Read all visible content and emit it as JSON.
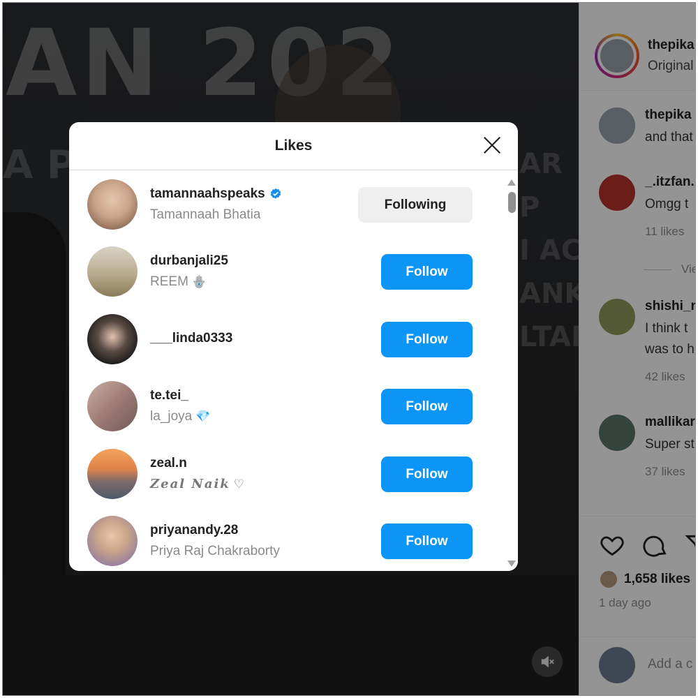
{
  "media": {
    "bg_text_line1": "AN 202",
    "bg_text_line2": "A PA   ND",
    "side_text": "AR P\nI AC\nANKA\nLTANT"
  },
  "panel": {
    "username": "thepika",
    "subtitle": "Original",
    "comments": [
      {
        "name": "thepika",
        "text": "and that",
        "likes": ""
      },
      {
        "name": "_.itzfan.",
        "text": "Omgg t",
        "likes": "11 likes"
      },
      {
        "name": "shishi_n",
        "text": "I think t\nwas to h",
        "likes": "42 likes"
      },
      {
        "name": "mallikar",
        "text": "Super st",
        "likes": "37 likes"
      }
    ],
    "view_replies": "Vie",
    "likes_count": "1,658 likes",
    "time": "1 day ago",
    "add_comment_placeholder": "Add a c"
  },
  "modal": {
    "title": "Likes",
    "users": [
      {
        "username": "tamannaahspeaks",
        "fullname": "Tamannaah Bhatia",
        "verified": true,
        "button": "Following",
        "avatar_color": "#c9a48a"
      },
      {
        "username": "durbanjali25",
        "fullname": "REEM",
        "emoji": "🪬",
        "button": "Follow",
        "avatar_color": "#b9ab8f"
      },
      {
        "username": "___linda0333",
        "fullname": "",
        "button": "Follow",
        "avatar_color": "#2b2b2b"
      },
      {
        "username": "te.tei_",
        "fullname": "la_joya",
        "emoji": "💎",
        "button": "Follow",
        "avatar_color": "#9e7b74"
      },
      {
        "username": "zeal.n",
        "fullname": "Zeal Naik",
        "emoji": "♡",
        "button": "Follow",
        "avatar_color": "#e0834a"
      },
      {
        "username": "priyanandy.28",
        "fullname": "Priya Raj Chakraborty",
        "button": "Follow",
        "avatar_color": "#c7a38a"
      }
    ]
  },
  "icons": {
    "close": "close-icon",
    "heart": "heart-icon",
    "comment": "comment-icon",
    "share": "share-icon",
    "mute": "mute-icon",
    "verified": "verified-badge-icon"
  },
  "colors": {
    "follow_button": "#0c95f6",
    "following_button": "#efefef",
    "verified": "#1a8cf0"
  }
}
